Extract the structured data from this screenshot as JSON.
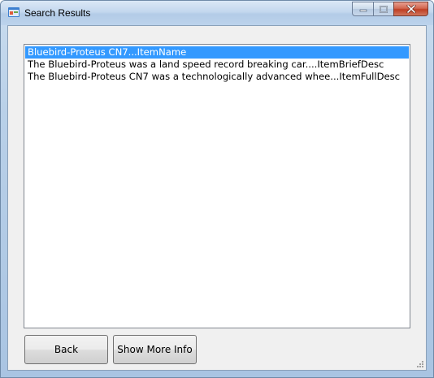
{
  "window": {
    "title": "Search Results"
  },
  "caption_buttons": {
    "minimize_icon": "minimize-icon",
    "maximize_icon": "maximize-icon",
    "close_icon": "close-icon"
  },
  "results": {
    "items": [
      {
        "text": "Bluebird-Proteus CN7...ItemName",
        "selected": true
      },
      {
        "text": "The Bluebird-Proteus was a land speed record breaking car....ItemBriefDesc",
        "selected": false
      },
      {
        "text": "The Bluebird-Proteus CN7 was a technologically advanced whee...ItemFullDesc",
        "selected": false
      }
    ]
  },
  "buttons": {
    "back_label": "Back",
    "more_info_label": "Show More Info"
  },
  "colors": {
    "selection": "#3399ff",
    "close_button": "#c7472c"
  }
}
